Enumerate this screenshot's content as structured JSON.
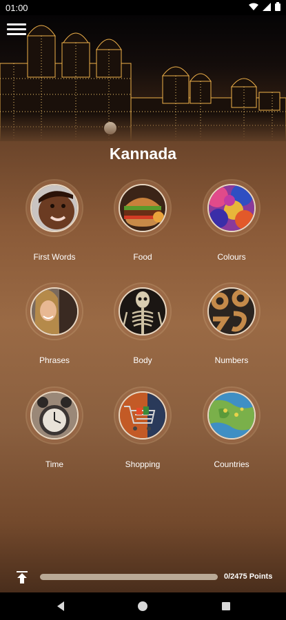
{
  "status_bar": {
    "time": "01:00"
  },
  "header": {
    "title": "Kannada"
  },
  "categories": [
    {
      "label": "First Words",
      "icon": "child-face-photo"
    },
    {
      "label": "Food",
      "icon": "burger-photo"
    },
    {
      "label": "Colours",
      "icon": "color-powder-photo"
    },
    {
      "label": "Phrases",
      "icon": "woman-talking-photo"
    },
    {
      "label": "Body",
      "icon": "skeleton-photo"
    },
    {
      "label": "Numbers",
      "icon": "numbers-photo"
    },
    {
      "label": "Time",
      "icon": "alarm-clock-photo"
    },
    {
      "label": "Shopping",
      "icon": "shopping-cart-photo"
    },
    {
      "label": "Countries",
      "icon": "map-photo"
    }
  ],
  "progress": {
    "points_text": "0/2475 Points",
    "fraction": 0
  },
  "colors": {
    "background": "#8a5a38",
    "ring": "#e8d7c2",
    "text": "#ffffff"
  }
}
